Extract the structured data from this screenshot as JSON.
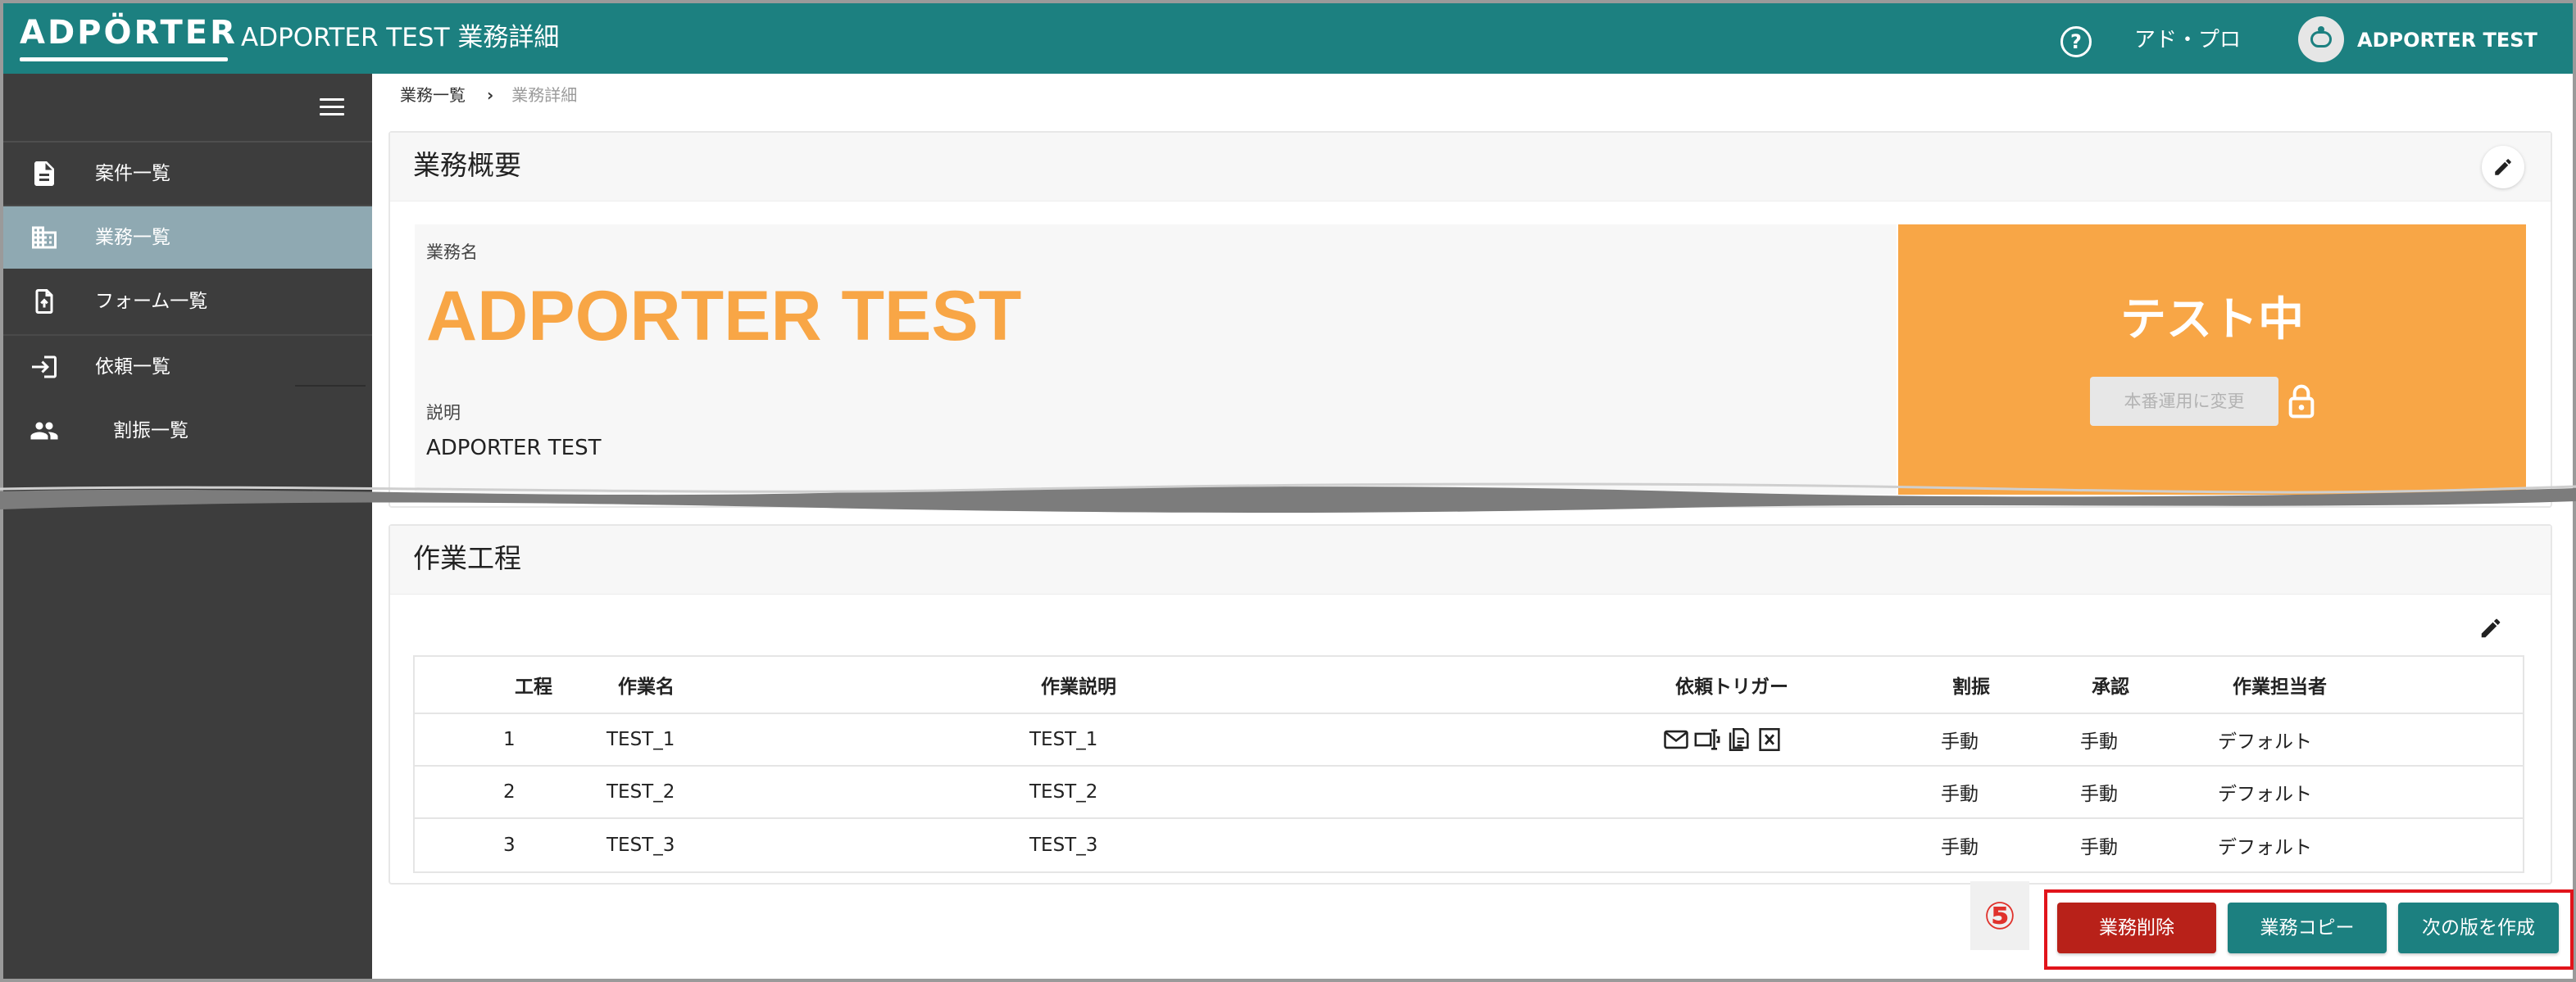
{
  "header": {
    "logo_text": "ADPÖRTER",
    "title": "ADPORTER TEST 業務詳細",
    "role": "アド・プロ",
    "user_name": "ADPORTER TEST"
  },
  "sidebar": {
    "items": [
      {
        "label": "案件一覧",
        "icon": "document-icon"
      },
      {
        "label": "業務一覧",
        "icon": "building-icon",
        "active": true
      },
      {
        "label": "フォーム一覧",
        "icon": "form-icon"
      },
      {
        "label": "依頼一覧",
        "icon": "login-arrow-icon"
      },
      {
        "label": "割振一覧",
        "icon": "people-icon"
      }
    ]
  },
  "breadcrumb": {
    "parent": "業務一覧",
    "current": "業務詳細"
  },
  "overview": {
    "title": "業務概要",
    "name_label": "業務名",
    "name_value": "ADPORTER TEST",
    "desc_label": "説明",
    "desc_value": "ADPORTER TEST",
    "status": "テスト中",
    "prod_button": "本番運用に変更"
  },
  "process": {
    "title": "作業工程",
    "columns": [
      "工程",
      "作業名",
      "作業説明",
      "依頼トリガー",
      "割振",
      "承認",
      "作業担当者"
    ],
    "rows": [
      {
        "step": "1",
        "name": "TEST_1",
        "desc": "TEST_1",
        "assign": "手動",
        "approve": "手動",
        "worker": "デフォルト",
        "triggers": [
          "mail-icon",
          "form-input-icon",
          "document-copy-icon",
          "excel-icon"
        ]
      },
      {
        "step": "2",
        "name": "TEST_2",
        "desc": "TEST_2",
        "assign": "手動",
        "approve": "手動",
        "worker": "デフォルト"
      },
      {
        "step": "3",
        "name": "TEST_3",
        "desc": "TEST_3",
        "assign": "手動",
        "approve": "手動",
        "worker": "デフォルト"
      }
    ]
  },
  "annotation": {
    "marker": "⑤"
  },
  "actions": {
    "delete": "業務削除",
    "copy": "業務コピー",
    "next_version": "次の版を作成"
  },
  "colors": {
    "header": "#1c8080",
    "sidebar": "#3d3d3d",
    "sidebar_active": "#8fa9b2",
    "accent_orange": "#f8a646",
    "danger": "#b82119",
    "highlight_border": "#e1141b"
  }
}
